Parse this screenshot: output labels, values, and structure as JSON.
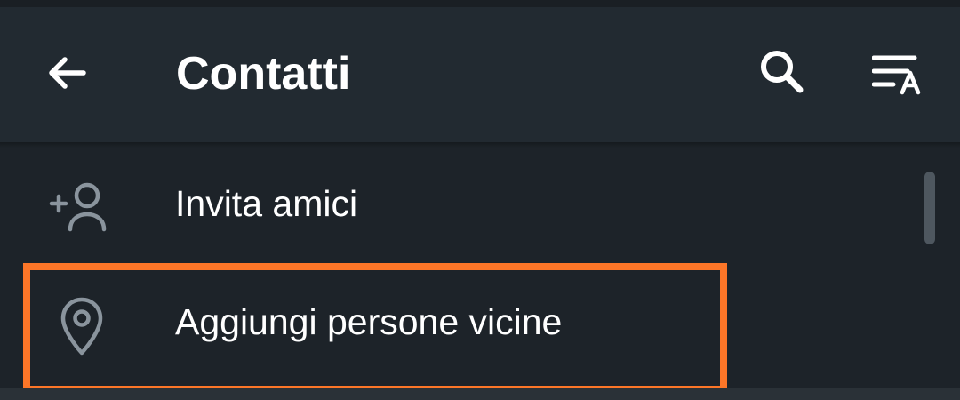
{
  "header": {
    "title": "Contatti",
    "back_icon": "arrow-back-icon",
    "search_icon": "search-icon",
    "sort_icon": "sort-by-name-icon"
  },
  "list": {
    "items": [
      {
        "label": "Invita amici",
        "icon": "add-person-icon"
      },
      {
        "label": "Aggiungi persone vicine",
        "icon": "location-pin-icon"
      }
    ]
  },
  "colors": {
    "background": "#1d2329",
    "app_bar": "#222a31",
    "text": "#ffffff",
    "icon_gray": "#8a949d",
    "highlight": "#fc7628",
    "scrollbar": "#4e575f"
  }
}
